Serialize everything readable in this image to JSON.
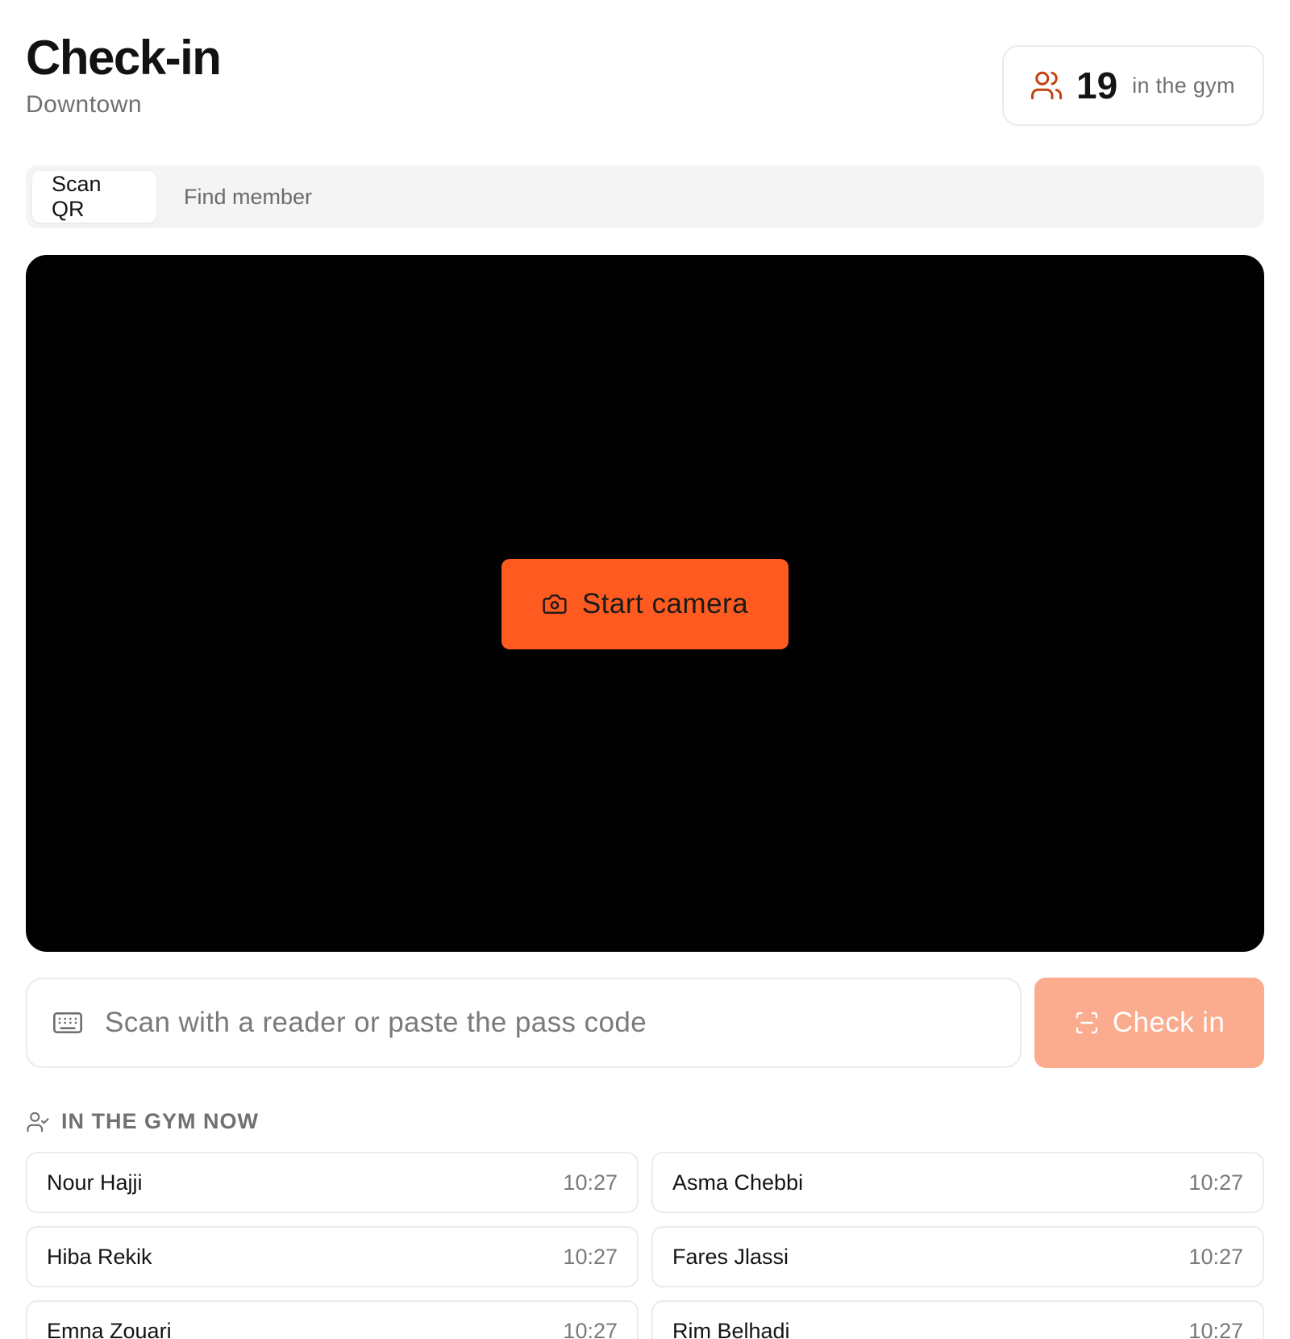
{
  "header": {
    "title": "Check-in",
    "subtitle": "Downtown"
  },
  "occupancy": {
    "icon": "users-icon",
    "count": "19",
    "label": "in the gym"
  },
  "tabs": [
    {
      "label": "Scan QR",
      "active": true
    },
    {
      "label": "Find member",
      "active": false
    }
  ],
  "camera": {
    "button_icon": "camera-icon",
    "button_label": "Start camera"
  },
  "code_entry": {
    "icon": "keyboard-icon",
    "placeholder": "Scan with a reader or paste the pass code",
    "value": "",
    "button_icon": "scan-icon",
    "button_label": "Check in"
  },
  "in_gym": {
    "icon": "user-check-icon",
    "title": "IN THE GYM NOW",
    "members": [
      {
        "name": "Nour Hajji",
        "time": "10:27"
      },
      {
        "name": "Asma Chebbi",
        "time": "10:27"
      },
      {
        "name": "Hiba Rekik",
        "time": "10:27"
      },
      {
        "name": "Fares Jlassi",
        "time": "10:27"
      },
      {
        "name": "Emna Zouari",
        "time": "10:27"
      },
      {
        "name": "Rim Belhadi",
        "time": "10:27"
      }
    ]
  },
  "colors": {
    "accent": "#ff5a1f",
    "accent_disabled": "#fbab8e",
    "icon_accent": "#c2410c",
    "muted_text": "#707070",
    "border": "#ebebeb"
  }
}
